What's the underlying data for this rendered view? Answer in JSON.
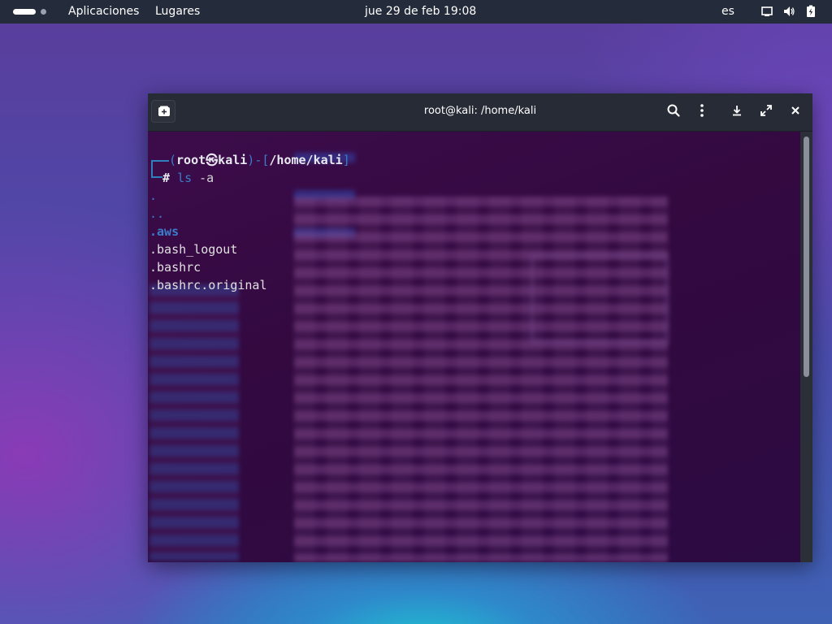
{
  "topbar": {
    "apps_label": "Aplicaciones",
    "places_label": "Lugares",
    "clock": "jue 29 de feb  19:08",
    "language": "es",
    "icons": [
      "workspace-indicator-icon",
      "display-icon",
      "volume-icon",
      "battery-icon"
    ]
  },
  "terminal": {
    "title": "root@kali: /home/kali",
    "prompt": {
      "open": "(",
      "user": "root",
      "at_symbol": "㉿",
      "host": "kali",
      "close": ")-[",
      "path": "/home/kali",
      "end": "]",
      "hash": "# ",
      "command": "ls",
      "argument": " -a"
    },
    "entries": [
      {
        "name": ".",
        "kind": "dir"
      },
      {
        "name": "..",
        "kind": "dir"
      },
      {
        "name": ".aws",
        "kind": "dir-bold"
      },
      {
        "name": ".bash_logout",
        "kind": "file"
      },
      {
        "name": ".bashrc",
        "kind": "file"
      },
      {
        "name": ".bashrc.original",
        "kind": "file"
      }
    ],
    "buttons": [
      "new-tab",
      "search",
      "menu",
      "download",
      "maximize",
      "close"
    ]
  },
  "colors": {
    "topbar_bg": "#242b3a",
    "terminal_bg": "#30093a",
    "prompt_blue": "#3a7cc8"
  }
}
